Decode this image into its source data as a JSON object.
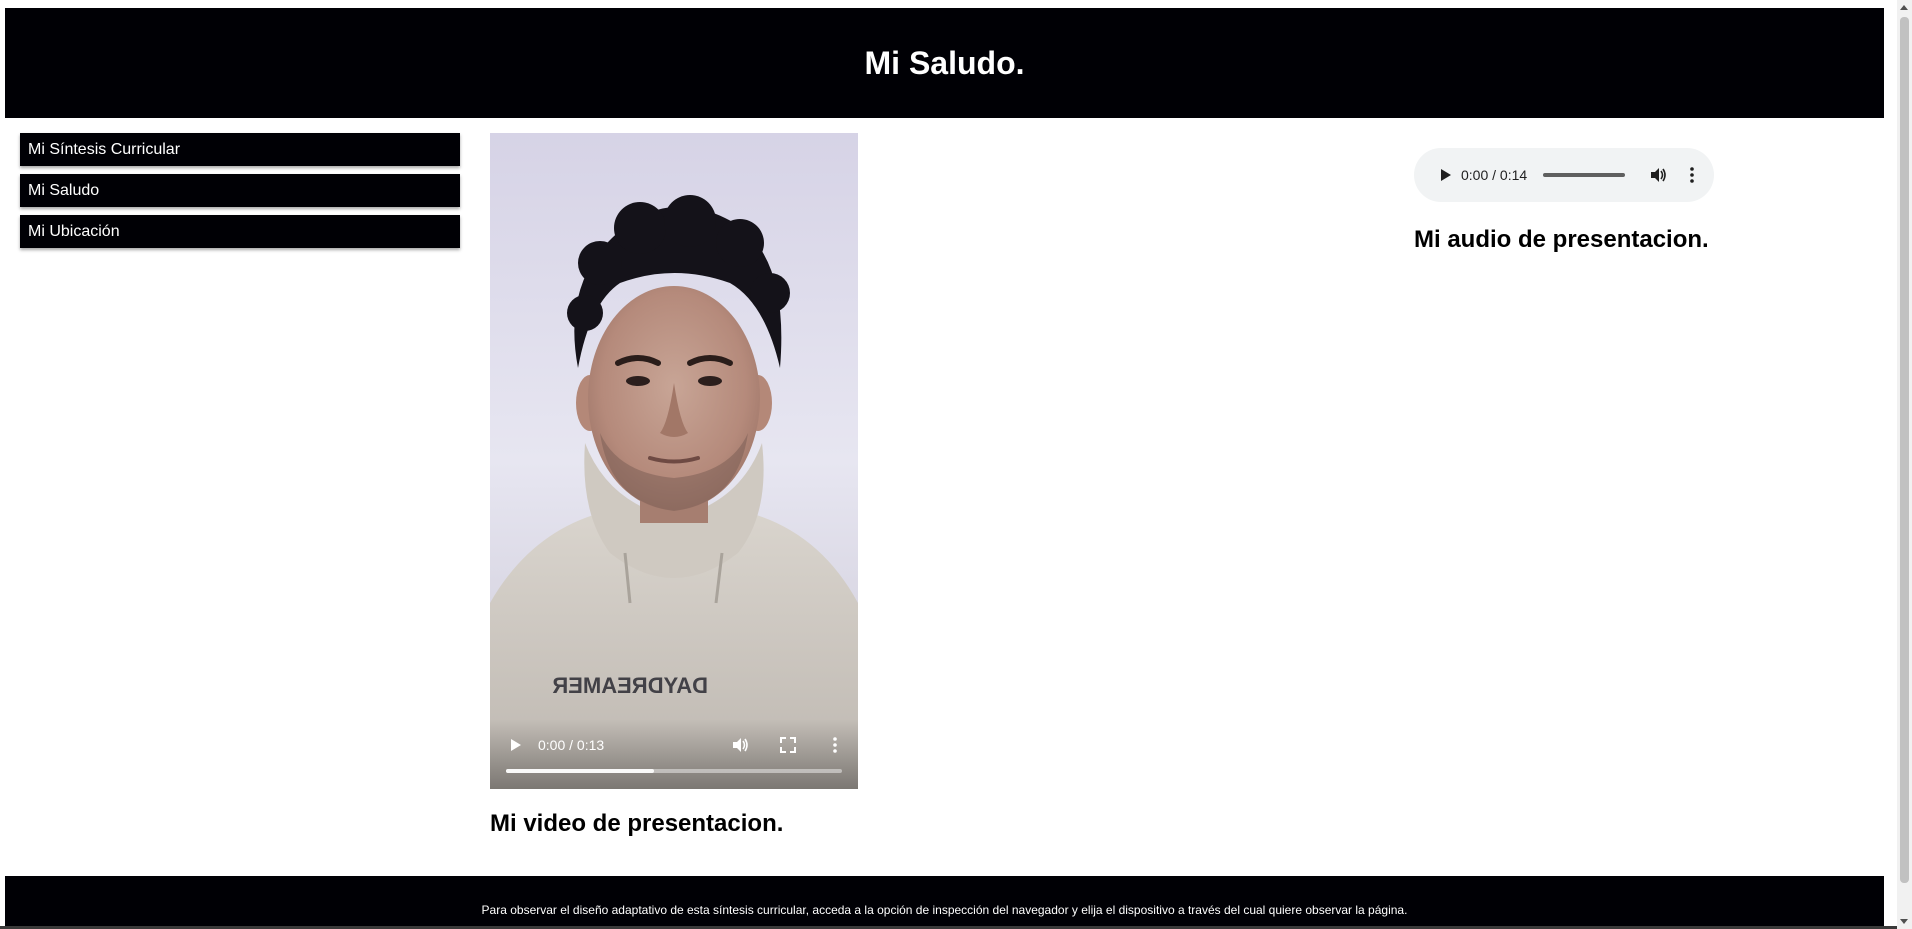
{
  "header": {
    "title": "Mi Saludo."
  },
  "sidebar": {
    "items": [
      {
        "label": "Mi Síntesis Curricular"
      },
      {
        "label": "Mi Saludo"
      },
      {
        "label": "Mi Ubicación"
      }
    ]
  },
  "video": {
    "time": "0:00 / 0:13",
    "buffered_fraction": 0.44,
    "shirt_text": "DAYDREAMER",
    "caption": "Mi video de presentacion."
  },
  "audio": {
    "time": "0:00 / 0:14",
    "caption": "Mi audio de presentacion."
  },
  "footer": {
    "text": "Para observar el diseño adaptativo de esta síntesis curricular, acceda a la opción de inspección del navegador y elija el dispositivo a través del cual quiere observar la página."
  },
  "colors": {
    "header_bg": "#000005",
    "nav_bg": "#000005",
    "footer_bg": "#000005",
    "audio_bg": "#f1f3f4"
  }
}
